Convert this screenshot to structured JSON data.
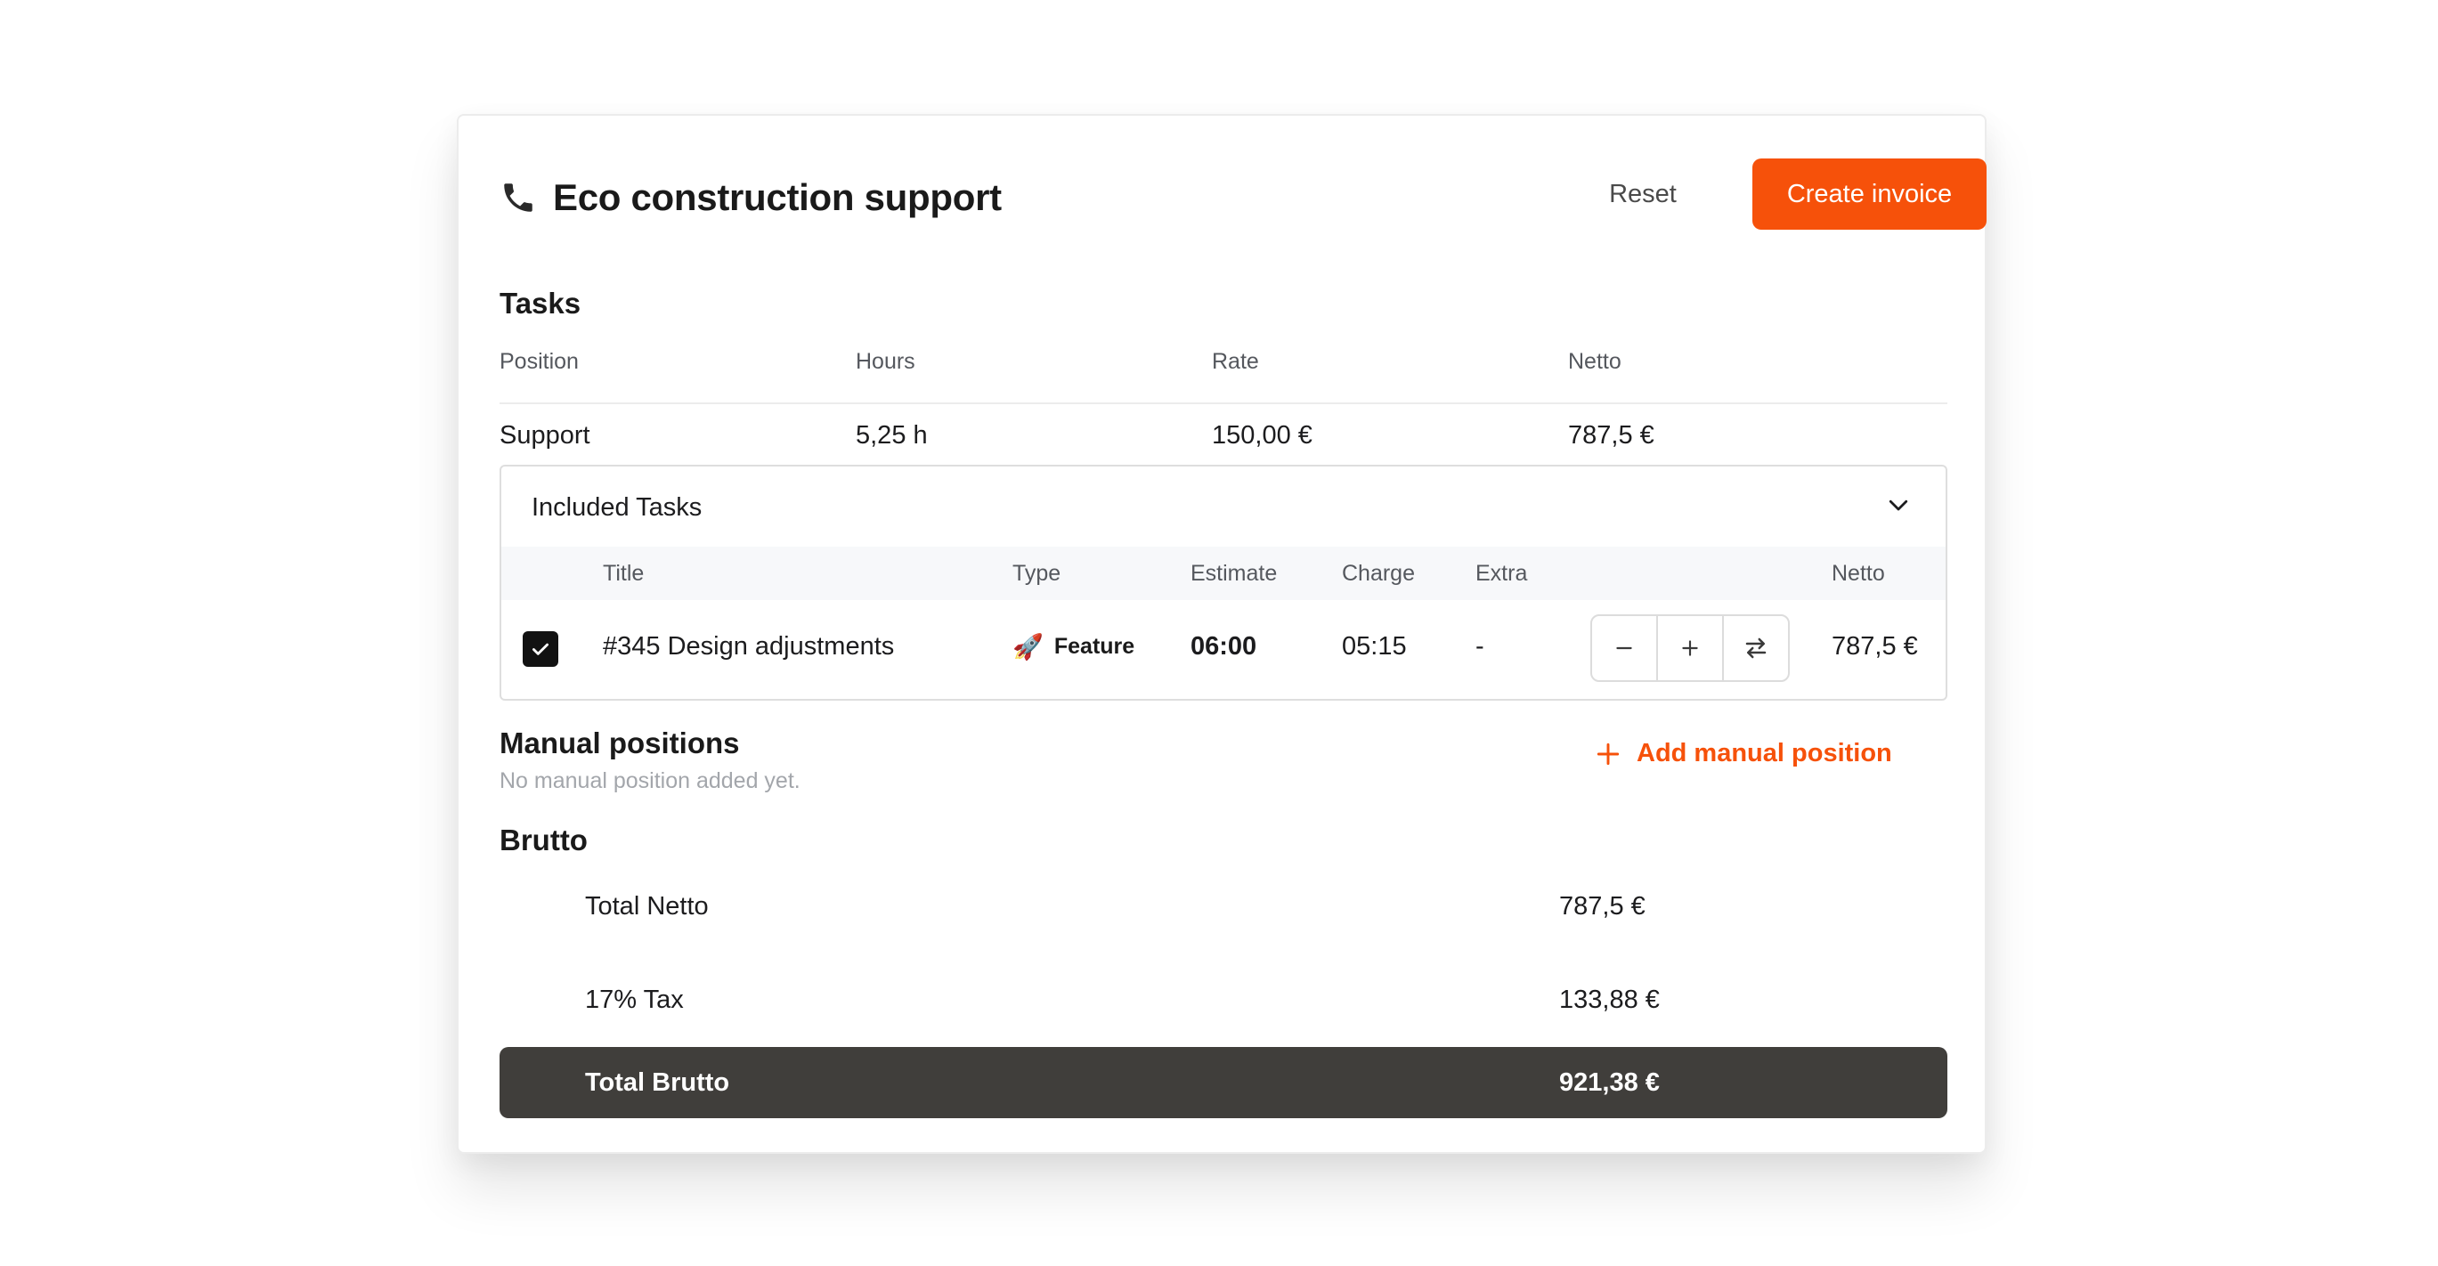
{
  "header": {
    "icon": "phone-icon",
    "title": "Eco construction support",
    "reset_label": "Reset",
    "create_label": "Create invoice",
    "accent_color": "#f6510a"
  },
  "tasks": {
    "section_title": "Tasks",
    "columns": [
      "Position",
      "Hours",
      "Rate",
      "Netto"
    ],
    "rows": [
      {
        "position": "Support",
        "hours": "5,25 h",
        "rate": "150,00 €",
        "netto": "787,5 €"
      }
    ]
  },
  "included_tasks": {
    "title": "Included Tasks",
    "columns": {
      "title": "Title",
      "type": "Type",
      "estimate": "Estimate",
      "charge": "Charge",
      "extra": "Extra",
      "netto": "Netto"
    },
    "rows": [
      {
        "checked": true,
        "title": "#345 Design adjustments",
        "type_icon": "rocket-icon",
        "type": "Feature",
        "estimate": "06:00",
        "charge": "05:15",
        "extra": "-",
        "netto": "787,5 €"
      }
    ]
  },
  "manual_positions": {
    "section_title": "Manual positions",
    "empty_text": "No manual position added yet.",
    "add_label": "Add manual position"
  },
  "brutto": {
    "section_title": "Brutto",
    "total_netto_label": "Total Netto",
    "total_netto_value": "787,5 €",
    "tax_label": "17% Tax",
    "tax_value": "133,88 €",
    "total_brutto_label": "Total Brutto",
    "total_brutto_value": "921,38 €",
    "total_bar_color": "#403e3b"
  }
}
